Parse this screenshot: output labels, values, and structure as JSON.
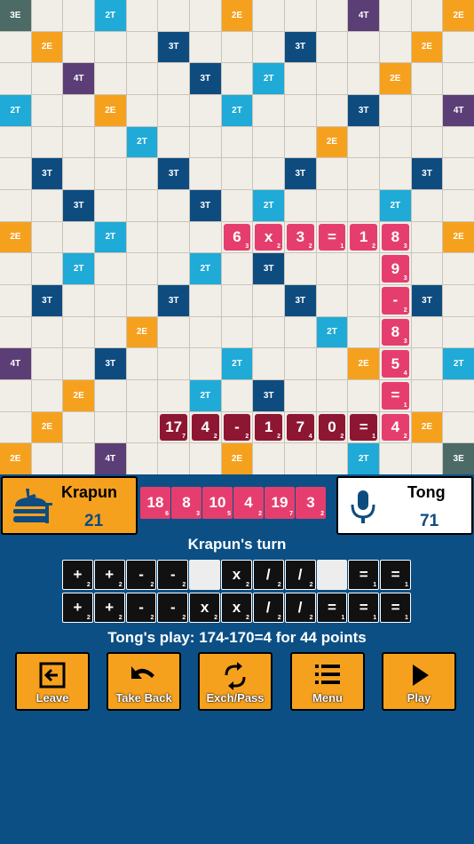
{
  "board_size": 15,
  "premiums": [
    {
      "r": 0,
      "c": 0,
      "t": "3E"
    },
    {
      "r": 0,
      "c": 3,
      "t": "2T"
    },
    {
      "r": 0,
      "c": 7,
      "t": "2E"
    },
    {
      "r": 0,
      "c": 11,
      "t": "4T"
    },
    {
      "r": 0,
      "c": 14,
      "t": "2E"
    },
    {
      "r": 1,
      "c": 1,
      "t": "2E"
    },
    {
      "r": 1,
      "c": 5,
      "t": "3T"
    },
    {
      "r": 1,
      "c": 9,
      "t": "3T"
    },
    {
      "r": 1,
      "c": 13,
      "t": "2E"
    },
    {
      "r": 2,
      "c": 2,
      "t": "4T"
    },
    {
      "r": 2,
      "c": 6,
      "t": "3T"
    },
    {
      "r": 2,
      "c": 8,
      "t": "2T"
    },
    {
      "r": 2,
      "c": 12,
      "t": "2E"
    },
    {
      "r": 3,
      "c": 0,
      "t": "2T"
    },
    {
      "r": 3,
      "c": 3,
      "t": "2E"
    },
    {
      "r": 3,
      "c": 7,
      "t": "2T"
    },
    {
      "r": 3,
      "c": 11,
      "t": "3T"
    },
    {
      "r": 3,
      "c": 14,
      "t": "4T"
    },
    {
      "r": 4,
      "c": 4,
      "t": "2T"
    },
    {
      "r": 4,
      "c": 10,
      "t": "2E"
    },
    {
      "r": 5,
      "c": 1,
      "t": "3T"
    },
    {
      "r": 5,
      "c": 5,
      "t": "3T"
    },
    {
      "r": 5,
      "c": 9,
      "t": "3T"
    },
    {
      "r": 5,
      "c": 13,
      "t": "3T"
    },
    {
      "r": 6,
      "c": 2,
      "t": "3T"
    },
    {
      "r": 6,
      "c": 6,
      "t": "3T"
    },
    {
      "r": 6,
      "c": 8,
      "t": "2T"
    },
    {
      "r": 6,
      "c": 12,
      "t": "2T"
    },
    {
      "r": 7,
      "c": 0,
      "t": "2E"
    },
    {
      "r": 7,
      "c": 3,
      "t": "2T"
    },
    {
      "r": 7,
      "c": 14,
      "t": "2E"
    },
    {
      "r": 8,
      "c": 2,
      "t": "2T"
    },
    {
      "r": 8,
      "c": 6,
      "t": "2T"
    },
    {
      "r": 8,
      "c": 8,
      "t": "3T"
    },
    {
      "r": 9,
      "c": 1,
      "t": "3T"
    },
    {
      "r": 9,
      "c": 5,
      "t": "3T"
    },
    {
      "r": 9,
      "c": 9,
      "t": "3T"
    },
    {
      "r": 9,
      "c": 13,
      "t": "3T"
    },
    {
      "r": 10,
      "c": 4,
      "t": "2E"
    },
    {
      "r": 10,
      "c": 10,
      "t": "2T"
    },
    {
      "r": 11,
      "c": 0,
      "t": "4T"
    },
    {
      "r": 11,
      "c": 3,
      "t": "3T"
    },
    {
      "r": 11,
      "c": 7,
      "t": "2T"
    },
    {
      "r": 11,
      "c": 11,
      "t": "2E"
    },
    {
      "r": 11,
      "c": 14,
      "t": "2T"
    },
    {
      "r": 12,
      "c": 2,
      "t": "2E"
    },
    {
      "r": 12,
      "c": 6,
      "t": "2T"
    },
    {
      "r": 12,
      "c": 8,
      "t": "3T"
    },
    {
      "r": 13,
      "c": 1,
      "t": "2E"
    },
    {
      "r": 13,
      "c": 13,
      "t": "2E"
    },
    {
      "r": 14,
      "c": 0,
      "t": "2E"
    },
    {
      "r": 14,
      "c": 3,
      "t": "4T"
    },
    {
      "r": 14,
      "c": 7,
      "t": "2E"
    },
    {
      "r": 14,
      "c": 11,
      "t": "2T"
    },
    {
      "r": 14,
      "c": 14,
      "t": "3E"
    }
  ],
  "tiles": [
    {
      "r": 7,
      "c": 7,
      "v": "6",
      "s": "3",
      "color": "pink"
    },
    {
      "r": 7,
      "c": 8,
      "v": "x",
      "s": "2",
      "color": "pink"
    },
    {
      "r": 7,
      "c": 9,
      "v": "3",
      "s": "2",
      "color": "pink"
    },
    {
      "r": 7,
      "c": 10,
      "v": "=",
      "s": "1",
      "color": "pink"
    },
    {
      "r": 7,
      "c": 11,
      "v": "1",
      "s": "2",
      "color": "pink"
    },
    {
      "r": 7,
      "c": 12,
      "v": "8",
      "s": "3",
      "color": "pink"
    },
    {
      "r": 8,
      "c": 12,
      "v": "9",
      "s": "3",
      "color": "pink"
    },
    {
      "r": 9,
      "c": 12,
      "v": "-",
      "s": "2",
      "color": "pink"
    },
    {
      "r": 10,
      "c": 12,
      "v": "8",
      "s": "3",
      "color": "pink"
    },
    {
      "r": 11,
      "c": 12,
      "v": "5",
      "s": "4",
      "color": "pink"
    },
    {
      "r": 12,
      "c": 12,
      "v": "=",
      "s": "1",
      "color": "pink"
    },
    {
      "r": 13,
      "c": 5,
      "v": "17",
      "s": "7",
      "color": "maroon"
    },
    {
      "r": 13,
      "c": 6,
      "v": "4",
      "s": "2",
      "color": "maroon"
    },
    {
      "r": 13,
      "c": 7,
      "v": "-",
      "s": "2",
      "color": "maroon"
    },
    {
      "r": 13,
      "c": 8,
      "v": "1",
      "s": "2",
      "color": "maroon"
    },
    {
      "r": 13,
      "c": 9,
      "v": "7",
      "s": "4",
      "color": "maroon"
    },
    {
      "r": 13,
      "c": 10,
      "v": "0",
      "s": "2",
      "color": "maroon"
    },
    {
      "r": 13,
      "c": 11,
      "v": "=",
      "s": "1",
      "color": "maroon"
    },
    {
      "r": 13,
      "c": 12,
      "v": "4",
      "s": "2",
      "color": "pink"
    }
  ],
  "player1": {
    "name": "Krapun",
    "score": "21",
    "color": "#f6a11e"
  },
  "player2": {
    "name": "Tong",
    "score": "71"
  },
  "bag_tiles": [
    {
      "v": "18",
      "s": "6"
    },
    {
      "v": "8",
      "s": "3"
    },
    {
      "v": "10",
      "s": "5"
    },
    {
      "v": "4",
      "s": "2"
    },
    {
      "v": "19",
      "s": "7"
    },
    {
      "v": "3",
      "s": "2"
    }
  ],
  "turn_label": "Krapun's turn",
  "rack1": [
    {
      "v": "+",
      "s": "2"
    },
    {
      "v": "+",
      "s": "2"
    },
    {
      "v": "-",
      "s": "2"
    },
    {
      "v": "-",
      "s": "2"
    },
    {
      "v": "",
      "s": ""
    },
    {
      "v": "x",
      "s": "2"
    },
    {
      "v": "/",
      "s": "2"
    },
    {
      "v": "/",
      "s": "2"
    },
    {
      "v": "",
      "s": ""
    },
    {
      "v": "=",
      "s": "1"
    },
    {
      "v": "=",
      "s": "1"
    }
  ],
  "rack2": [
    {
      "v": "+",
      "s": "2"
    },
    {
      "v": "+",
      "s": "2"
    },
    {
      "v": "-",
      "s": "2"
    },
    {
      "v": "-",
      "s": "2"
    },
    {
      "v": "x",
      "s": "2"
    },
    {
      "v": "x",
      "s": "2"
    },
    {
      "v": "/",
      "s": "2"
    },
    {
      "v": "/",
      "s": "2"
    },
    {
      "v": "=",
      "s": "1"
    },
    {
      "v": "=",
      "s": "1"
    },
    {
      "v": "=",
      "s": "1"
    }
  ],
  "last_play": "Tong's play: 174-170=4 for 44 points",
  "actions": {
    "leave": "Leave",
    "take_back": "Take Back",
    "exchange": "Exch/Pass",
    "menu": "Menu",
    "play": "Play"
  },
  "icons": {
    "player1_avatar": "burger-icon",
    "player2_avatar": "microphone-icon"
  }
}
